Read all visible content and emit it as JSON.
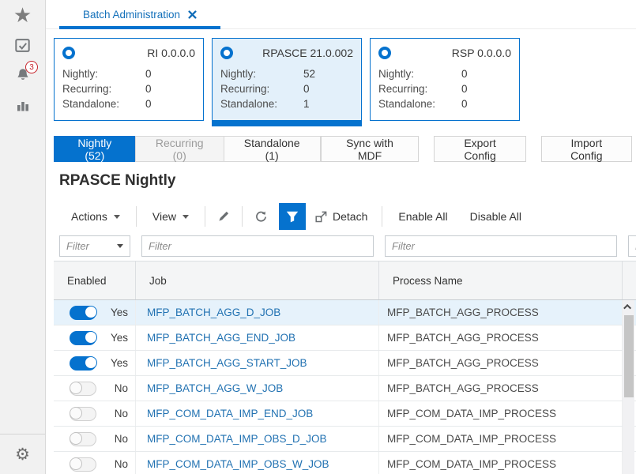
{
  "tab_bar": {
    "tab_label": "Batch Administration"
  },
  "sidebar": {
    "notification_count": "3"
  },
  "cards": [
    {
      "title": "RI 0.0.0.0",
      "selected": false,
      "rows": [
        {
          "label": "Nightly:",
          "value": "0"
        },
        {
          "label": "Recurring:",
          "value": "0"
        },
        {
          "label": "Standalone:",
          "value": "0"
        }
      ]
    },
    {
      "title": "RPASCE 21.0.002",
      "selected": true,
      "rows": [
        {
          "label": "Nightly:",
          "value": "52"
        },
        {
          "label": "Recurring:",
          "value": "0"
        },
        {
          "label": "Standalone:",
          "value": "1"
        }
      ]
    },
    {
      "title": "RSP 0.0.0.0",
      "selected": false,
      "rows": [
        {
          "label": "Nightly:",
          "value": "0"
        },
        {
          "label": "Recurring:",
          "value": "0"
        },
        {
          "label": "Standalone:",
          "value": "0"
        }
      ]
    }
  ],
  "type_tabs": [
    {
      "label": "Nightly (52)",
      "state": "active"
    },
    {
      "label": "Recurring (0)",
      "state": "disabled"
    },
    {
      "label": "Standalone (1)",
      "state": "default"
    }
  ],
  "config_buttons": [
    "Sync with MDF",
    "Export Config",
    "Import Config"
  ],
  "section_title": "RPASCE Nightly",
  "toolbar": {
    "actions": "Actions",
    "view": "View",
    "detach": "Detach",
    "enable_all": "Enable All",
    "disable_all": "Disable All"
  },
  "table": {
    "filter_placeholder": "Filter",
    "columns": [
      "Enabled",
      "Job",
      "Process Name"
    ],
    "rows": [
      {
        "enabled": true,
        "enabled_label": "Yes",
        "job": "MFP_BATCH_AGG_D_JOB",
        "process": "MFP_BATCH_AGG_PROCESS",
        "selected": true
      },
      {
        "enabled": true,
        "enabled_label": "Yes",
        "job": "MFP_BATCH_AGG_END_JOB",
        "process": "MFP_BATCH_AGG_PROCESS",
        "selected": false
      },
      {
        "enabled": true,
        "enabled_label": "Yes",
        "job": "MFP_BATCH_AGG_START_JOB",
        "process": "MFP_BATCH_AGG_PROCESS",
        "selected": false
      },
      {
        "enabled": false,
        "enabled_label": "No",
        "job": "MFP_BATCH_AGG_W_JOB",
        "process": "MFP_BATCH_AGG_PROCESS",
        "selected": false
      },
      {
        "enabled": false,
        "enabled_label": "No",
        "job": "MFP_COM_DATA_IMP_END_JOB",
        "process": "MFP_COM_DATA_IMP_PROCESS",
        "selected": false
      },
      {
        "enabled": false,
        "enabled_label": "No",
        "job": "MFP_COM_DATA_IMP_OBS_D_JOB",
        "process": "MFP_COM_DATA_IMP_PROCESS",
        "selected": false
      },
      {
        "enabled": false,
        "enabled_label": "No",
        "job": "MFP_COM_DATA_IMP_OBS_W_JOB",
        "process": "MFP_COM_DATA_IMP_PROCESS",
        "selected": false
      }
    ]
  },
  "colors": {
    "accent": "#0572ce",
    "link": "#2272b2",
    "selected_row": "#e6f2fb",
    "badge_red": "#c7242c"
  }
}
